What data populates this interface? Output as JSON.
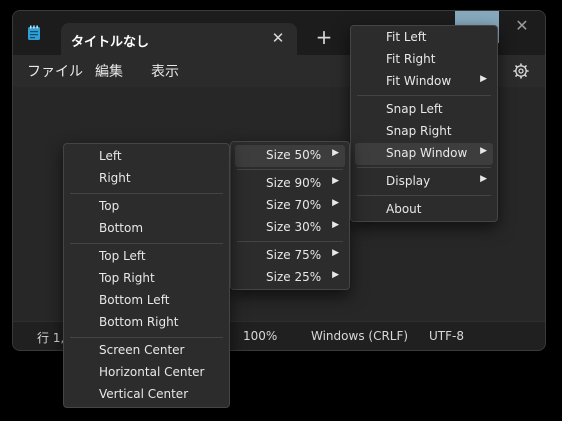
{
  "app": {
    "tab_title": "タイトルなし",
    "tab_close": "✕",
    "new_tab": "+",
    "window_close": "✕",
    "icons": {
      "app": "notepad-icon",
      "settings": "gear-icon"
    }
  },
  "menubar": {
    "file": "ファイル",
    "edit": "編集",
    "view": "表示"
  },
  "statusbar": {
    "position": "行 1,",
    "zoom": "100%",
    "line_ending": "Windows (CRLF)",
    "encoding": "UTF-8"
  },
  "right_menu": {
    "items": [
      "Fit Left",
      "Fit Right",
      "Fit Window",
      "Snap Left",
      "Snap Right",
      "Snap Window",
      "Display",
      "About"
    ]
  },
  "size_menu": {
    "items": [
      "Size 50%",
      "Size 90%",
      "Size 70%",
      "Size 30%",
      "Size 75%",
      "Size 25%"
    ]
  },
  "position_menu": {
    "items": [
      "Left",
      "Right",
      "Top",
      "Bottom",
      "Top Left",
      "Top Right",
      "Bottom Left",
      "Bottom Right",
      "Screen Center",
      "Horizontal Center",
      "Vertical Center"
    ]
  },
  "submenu_arrow": "▶",
  "colors": {
    "highlight": "#3d3d3d",
    "menu_bg": "#2c2c2c",
    "accent_button": "#86a9bd"
  }
}
